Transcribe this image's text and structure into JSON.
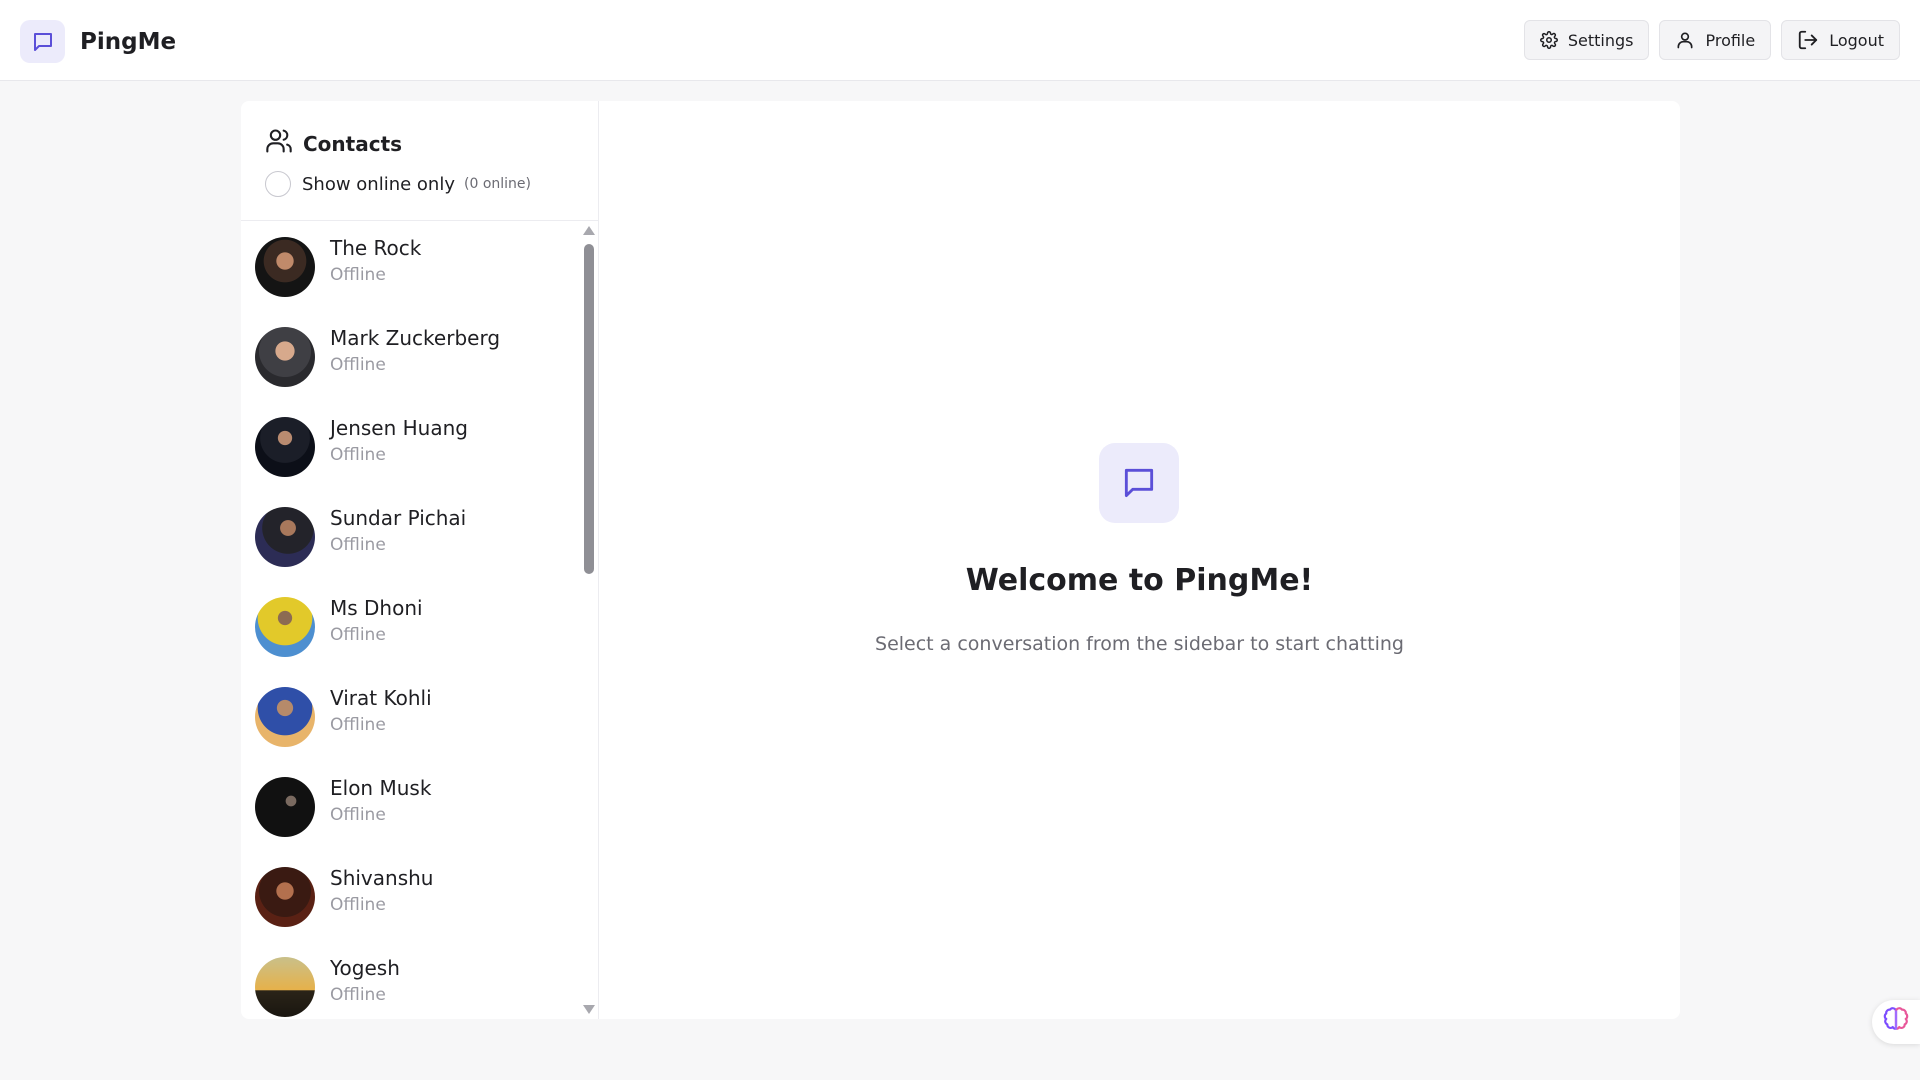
{
  "app": {
    "name": "PingMe",
    "accent": "#5b4fd8",
    "accent_soft": "#ecebfb"
  },
  "header": {
    "buttons": [
      {
        "label": "Settings",
        "icon": "gear-icon"
      },
      {
        "label": "Profile",
        "icon": "user-icon"
      },
      {
        "label": "Logout",
        "icon": "logout-icon"
      }
    ]
  },
  "sidebar": {
    "title": "Contacts",
    "filter_label": "Show online only",
    "online_count": "(0 online)",
    "filter_checked": false,
    "contacts": [
      {
        "name": "The Rock",
        "status": "Offline"
      },
      {
        "name": "Mark Zuckerberg",
        "status": "Offline"
      },
      {
        "name": "Jensen Huang",
        "status": "Offline"
      },
      {
        "name": "Sundar Pichai",
        "status": "Offline"
      },
      {
        "name": "Ms Dhoni",
        "status": "Offline"
      },
      {
        "name": "Virat Kohli",
        "status": "Offline"
      },
      {
        "name": "Elon Musk",
        "status": "Offline"
      },
      {
        "name": "Shivanshu",
        "status": "Offline"
      },
      {
        "name": "Yogesh",
        "status": "Offline"
      }
    ]
  },
  "main": {
    "welcome_title": "Welcome to PingMe!",
    "welcome_subtitle": "Select a conversation from the sidebar to start chatting"
  }
}
